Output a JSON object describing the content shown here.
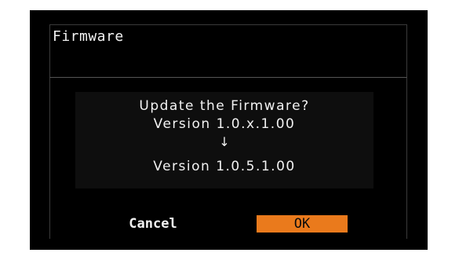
{
  "dialog": {
    "title": "Firmware",
    "message_lines": [
      "Update the Firmware?",
      "Version 1.0.x.1.00",
      "↓",
      "Version 1.0.5.1.00"
    ],
    "buttons": {
      "cancel": "Cancel",
      "ok": "OK"
    }
  },
  "colors": {
    "background": "#000000",
    "text": "#f2f2f2",
    "selected_button": "#ea7a1c"
  }
}
